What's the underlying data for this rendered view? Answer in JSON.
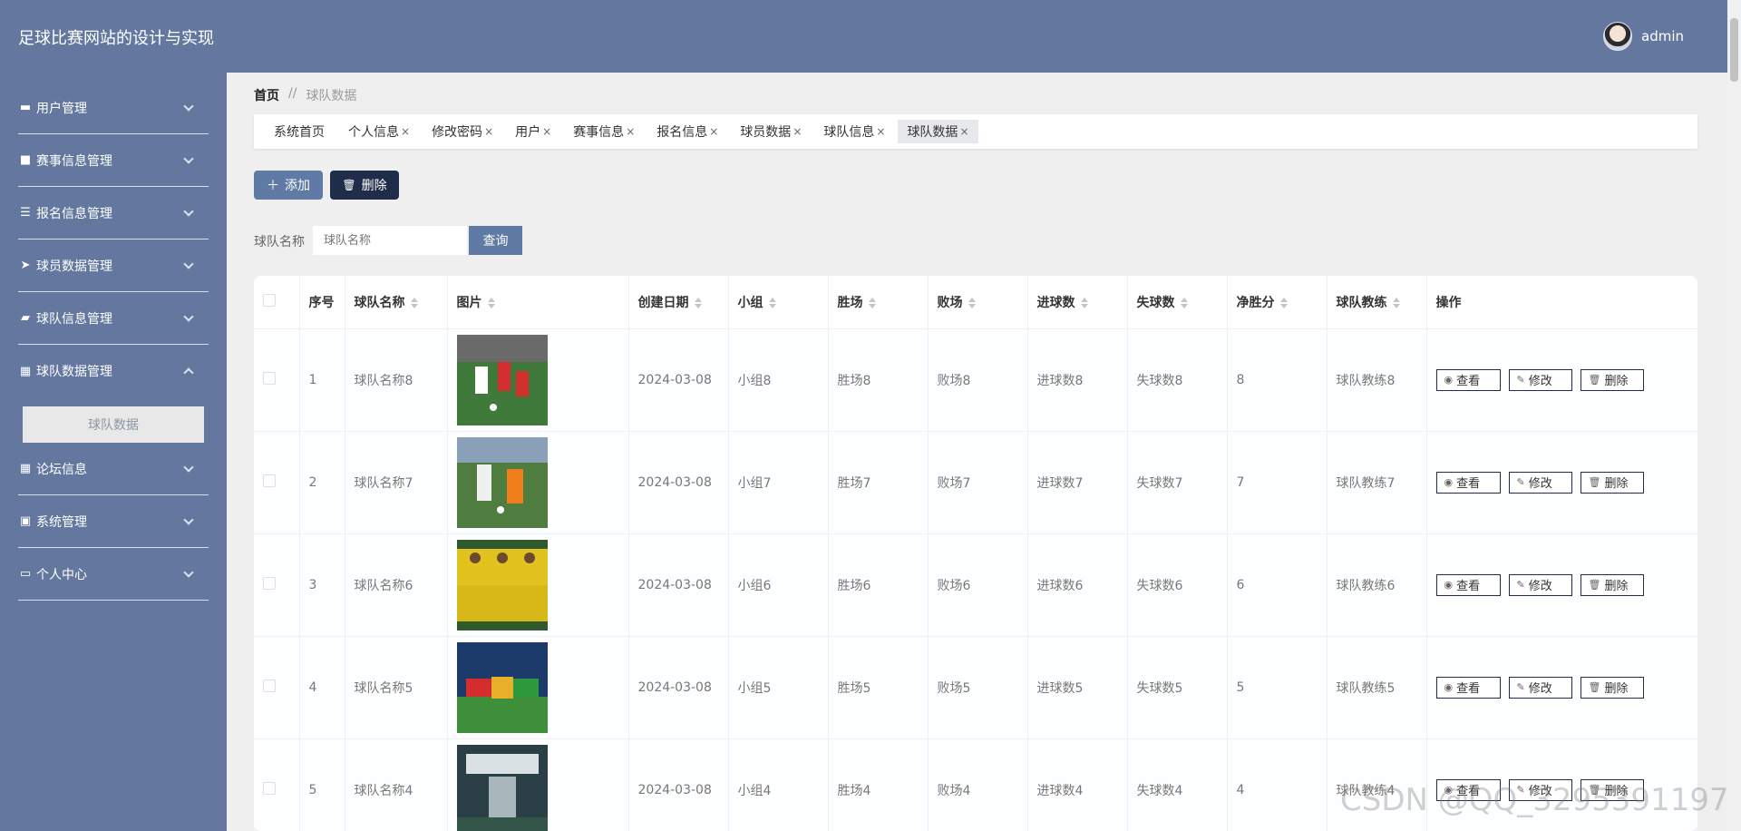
{
  "header": {
    "title": "足球比赛网站的设计与实现",
    "username": "admin"
  },
  "sidebar": {
    "items": [
      {
        "label": "用户管理",
        "icon": "chat-icon",
        "glyph": "▬"
      },
      {
        "label": "赛事信息管理",
        "icon": "briefcase-icon",
        "glyph": "■"
      },
      {
        "label": "报名信息管理",
        "icon": "list-icon",
        "glyph": "☰"
      },
      {
        "label": "球员数据管理",
        "icon": "send-icon",
        "glyph": "➤"
      },
      {
        "label": "球队信息管理",
        "icon": "ticket-icon",
        "glyph": "▰"
      },
      {
        "label": "球队数据管理",
        "icon": "grid-icon",
        "glyph": "▦"
      },
      {
        "label": "论坛信息",
        "icon": "grid-icon",
        "glyph": "▦"
      },
      {
        "label": "系统管理",
        "icon": "clipboard-icon",
        "glyph": "▣"
      },
      {
        "label": "个人中心",
        "icon": "card-icon",
        "glyph": "▭"
      }
    ],
    "active_sub": "球队数据"
  },
  "breadcrumb": {
    "home": "首页",
    "sep": "//",
    "current": "球队数据"
  },
  "tags": [
    {
      "label": "系统首页",
      "close": ""
    },
    {
      "label": "个人信息",
      "close": "×"
    },
    {
      "label": "修改密码",
      "close": "×"
    },
    {
      "label": "用户",
      "close": "×"
    },
    {
      "label": "赛事信息",
      "close": "×"
    },
    {
      "label": "报名信息",
      "close": "×"
    },
    {
      "label": "球员数据",
      "close": "×"
    },
    {
      "label": "球队信息",
      "close": "×"
    },
    {
      "label": "球队数据",
      "close": "×"
    }
  ],
  "toolbar": {
    "add_label": "添加",
    "delete_label": "删除"
  },
  "search": {
    "label": "球队名称",
    "placeholder": "球队名称",
    "button": "查询"
  },
  "table": {
    "headers": [
      "序号",
      "球队名称",
      "图片",
      "创建日期",
      "小组",
      "胜场",
      "败场",
      "进球数",
      "失球数",
      "净胜分",
      "球队教练",
      "操作"
    ],
    "rows": [
      {
        "no": "1",
        "name": "球队名称8",
        "date": "2024-03-08",
        "group": "小组8",
        "wins": "胜场8",
        "losses": "败场8",
        "gf": "进球数8",
        "ga": "失球数8",
        "gd": "8",
        "coach": "球队教练8"
      },
      {
        "no": "2",
        "name": "球队名称7",
        "date": "2024-03-08",
        "group": "小组7",
        "wins": "胜场7",
        "losses": "败场7",
        "gf": "进球数7",
        "ga": "失球数7",
        "gd": "7",
        "coach": "球队教练7"
      },
      {
        "no": "3",
        "name": "球队名称6",
        "date": "2024-03-08",
        "group": "小组6",
        "wins": "胜场6",
        "losses": "败场6",
        "gf": "进球数6",
        "ga": "失球数6",
        "gd": "6",
        "coach": "球队教练6"
      },
      {
        "no": "4",
        "name": "球队名称5",
        "date": "2024-03-08",
        "group": "小组5",
        "wins": "胜场5",
        "losses": "败场5",
        "gf": "进球数5",
        "ga": "失球数5",
        "gd": "5",
        "coach": "球队教练5"
      },
      {
        "no": "5",
        "name": "球队名称4",
        "date": "2024-03-08",
        "group": "小组4",
        "wins": "胜场4",
        "losses": "败场4",
        "gf": "进球数4",
        "ga": "失球数4",
        "gd": "4",
        "coach": "球队教练4"
      }
    ],
    "actions": {
      "view": "查看",
      "edit": "修改",
      "delete": "删除"
    }
  },
  "watermark": "CSDN @QQ_3295391197"
}
